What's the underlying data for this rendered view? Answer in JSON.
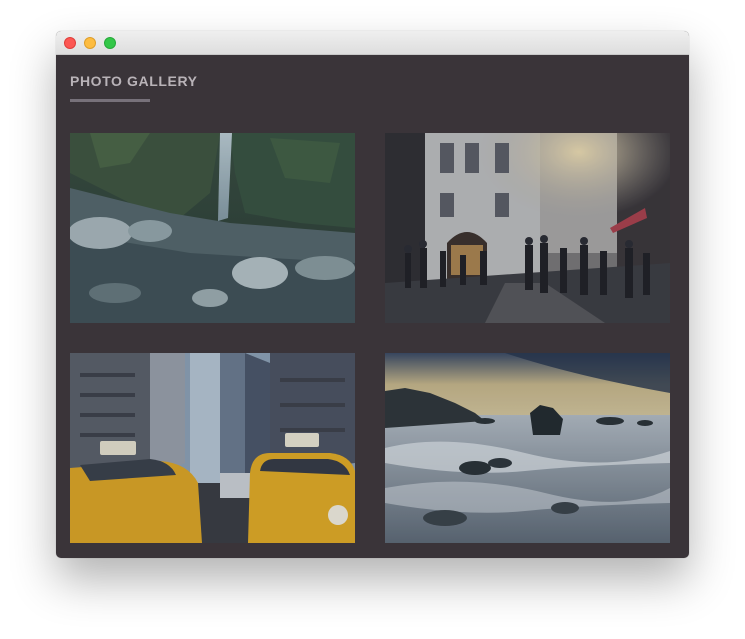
{
  "gallery": {
    "title": "PHOTO GALLERY",
    "photos": [
      {
        "subject": "waterfall-canyon"
      },
      {
        "subject": "city-street-crowd"
      },
      {
        "subject": "yellow-taxis-city"
      },
      {
        "subject": "rocky-seashore-sunset"
      }
    ]
  },
  "colors": {
    "window_background": "#3a3439",
    "title_text": "#b9b3b8",
    "title_underline": "#77717a",
    "traffic_close": "#fc5753",
    "traffic_minimize": "#fdbc40",
    "traffic_maximize": "#33c748"
  }
}
